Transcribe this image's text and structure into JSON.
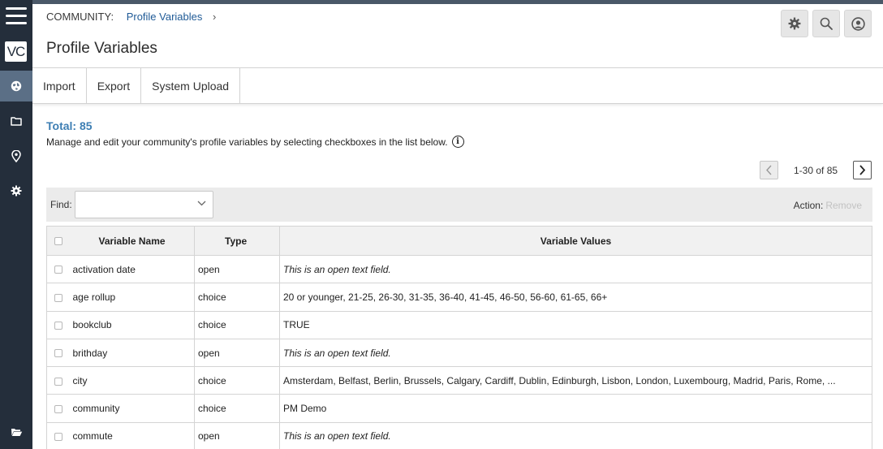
{
  "app": {
    "logo_text": "VC",
    "nav_icons": [
      "globe-icon",
      "folder-icon",
      "location-pin-icon",
      "gear-icon",
      "open-folder-icon"
    ]
  },
  "header": {
    "breadcrumb_root": "COMMUNITY:",
    "breadcrumb_link": "Profile Variables",
    "breadcrumb_chevron": "›",
    "title": "Profile Variables"
  },
  "toolbar": {
    "import_label": "Import",
    "export_label": "Export",
    "system_upload_label": "System Upload"
  },
  "summary": {
    "total": "Total: 85",
    "description": "Manage and edit your community's profile variables by selecting checkboxes in the list below.",
    "info_glyph": "i"
  },
  "pager": {
    "range": "1-30 of 85"
  },
  "find": {
    "label": "Find:",
    "value": ""
  },
  "action": {
    "label": "Action:",
    "remove_label": "Remove"
  },
  "table": {
    "headers": {
      "name": "Variable Name",
      "type": "Type",
      "values": "Variable Values"
    },
    "rows": [
      {
        "name": "activation date",
        "type": "open",
        "values": "This is an open text field.",
        "italic": true
      },
      {
        "name": "age rollup",
        "type": "choice",
        "values": "20 or younger, 21-25, 26-30, 31-35, 36-40, 41-45, 46-50, 56-60, 61-65, 66+",
        "italic": false
      },
      {
        "name": "bookclub",
        "type": "choice",
        "values": "TRUE",
        "italic": false
      },
      {
        "name": "brithday",
        "type": "open",
        "values": "This is an open text field.",
        "italic": true
      },
      {
        "name": "city",
        "type": "choice",
        "values": "Amsterdam, Belfast, Berlin, Brussels, Calgary, Cardiff, Dublin, Edinburgh, Lisbon, London, Luxembourg, Madrid, Paris, Rome, ...",
        "italic": false
      },
      {
        "name": "community",
        "type": "choice",
        "values": "PM Demo",
        "italic": false
      },
      {
        "name": "commute",
        "type": "open",
        "values": "This is an open text field.",
        "italic": true
      }
    ]
  }
}
